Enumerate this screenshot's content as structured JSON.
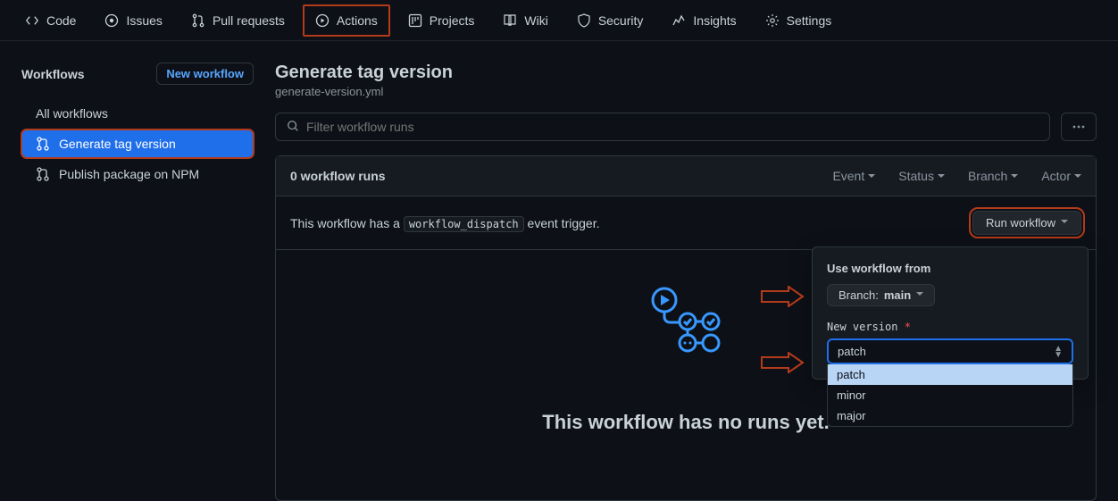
{
  "nav": {
    "code": "Code",
    "issues": "Issues",
    "pull_requests": "Pull requests",
    "actions": "Actions",
    "projects": "Projects",
    "wiki": "Wiki",
    "security": "Security",
    "insights": "Insights",
    "settings": "Settings"
  },
  "sidebar": {
    "title": "Workflows",
    "new_workflow": "New workflow",
    "all_workflows": "All workflows",
    "items": [
      {
        "label": "Generate tag version"
      },
      {
        "label": "Publish package on NPM"
      }
    ]
  },
  "main": {
    "title": "Generate tag version",
    "filename": "generate-version.yml",
    "filter_placeholder": "Filter workflow runs",
    "runs_count": "0 workflow runs",
    "filters": {
      "event": "Event",
      "status": "Status",
      "branch": "Branch",
      "actor": "Actor"
    },
    "dispatch_prefix": "This workflow has a ",
    "dispatch_code": "workflow_dispatch",
    "dispatch_suffix": " event trigger.",
    "run_workflow_btn": "Run workflow",
    "empty_msg": "This workflow has no runs yet."
  },
  "popover": {
    "use_from": "Use workflow from",
    "branch_label": "Branch: ",
    "branch_value": "main",
    "field_label": "New version",
    "required_marker": "*",
    "selected": "patch",
    "options": [
      "patch",
      "minor",
      "major"
    ]
  }
}
